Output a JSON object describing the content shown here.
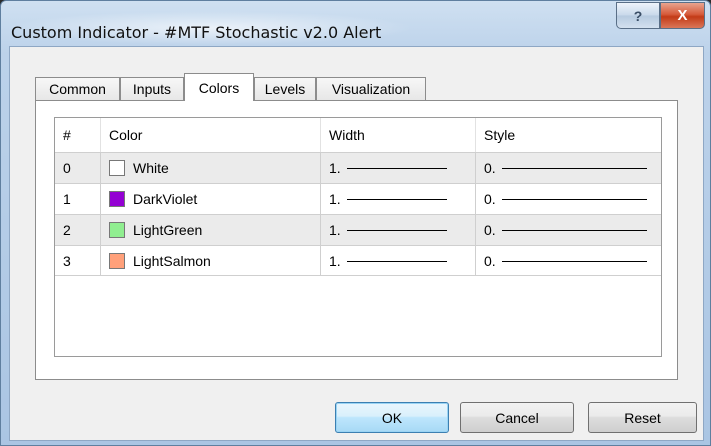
{
  "window": {
    "title": "Custom Indicator - #MTF Stochastic v2.0 Alert",
    "help": "?",
    "close": "X"
  },
  "tabs": [
    {
      "label": "Common",
      "active": false
    },
    {
      "label": "Inputs",
      "active": false
    },
    {
      "label": "Colors",
      "active": true
    },
    {
      "label": "Levels",
      "active": false
    },
    {
      "label": "Visualization",
      "active": false
    }
  ],
  "table": {
    "headers": [
      "#",
      "Color",
      "Width",
      "Style"
    ],
    "rows": [
      {
        "index": "0",
        "color_name": "White",
        "swatch": "#ffffff",
        "width": "1.",
        "style": "0."
      },
      {
        "index": "1",
        "color_name": "DarkViolet",
        "swatch": "#9400d3",
        "width": "1.",
        "style": "0."
      },
      {
        "index": "2",
        "color_name": "LightGreen",
        "swatch": "#90ee90",
        "width": "1.",
        "style": "0."
      },
      {
        "index": "3",
        "color_name": "LightSalmon",
        "swatch": "#ffa07a",
        "width": "1.",
        "style": "0."
      }
    ]
  },
  "buttons": {
    "ok": "OK",
    "cancel": "Cancel",
    "reset": "Reset"
  }
}
